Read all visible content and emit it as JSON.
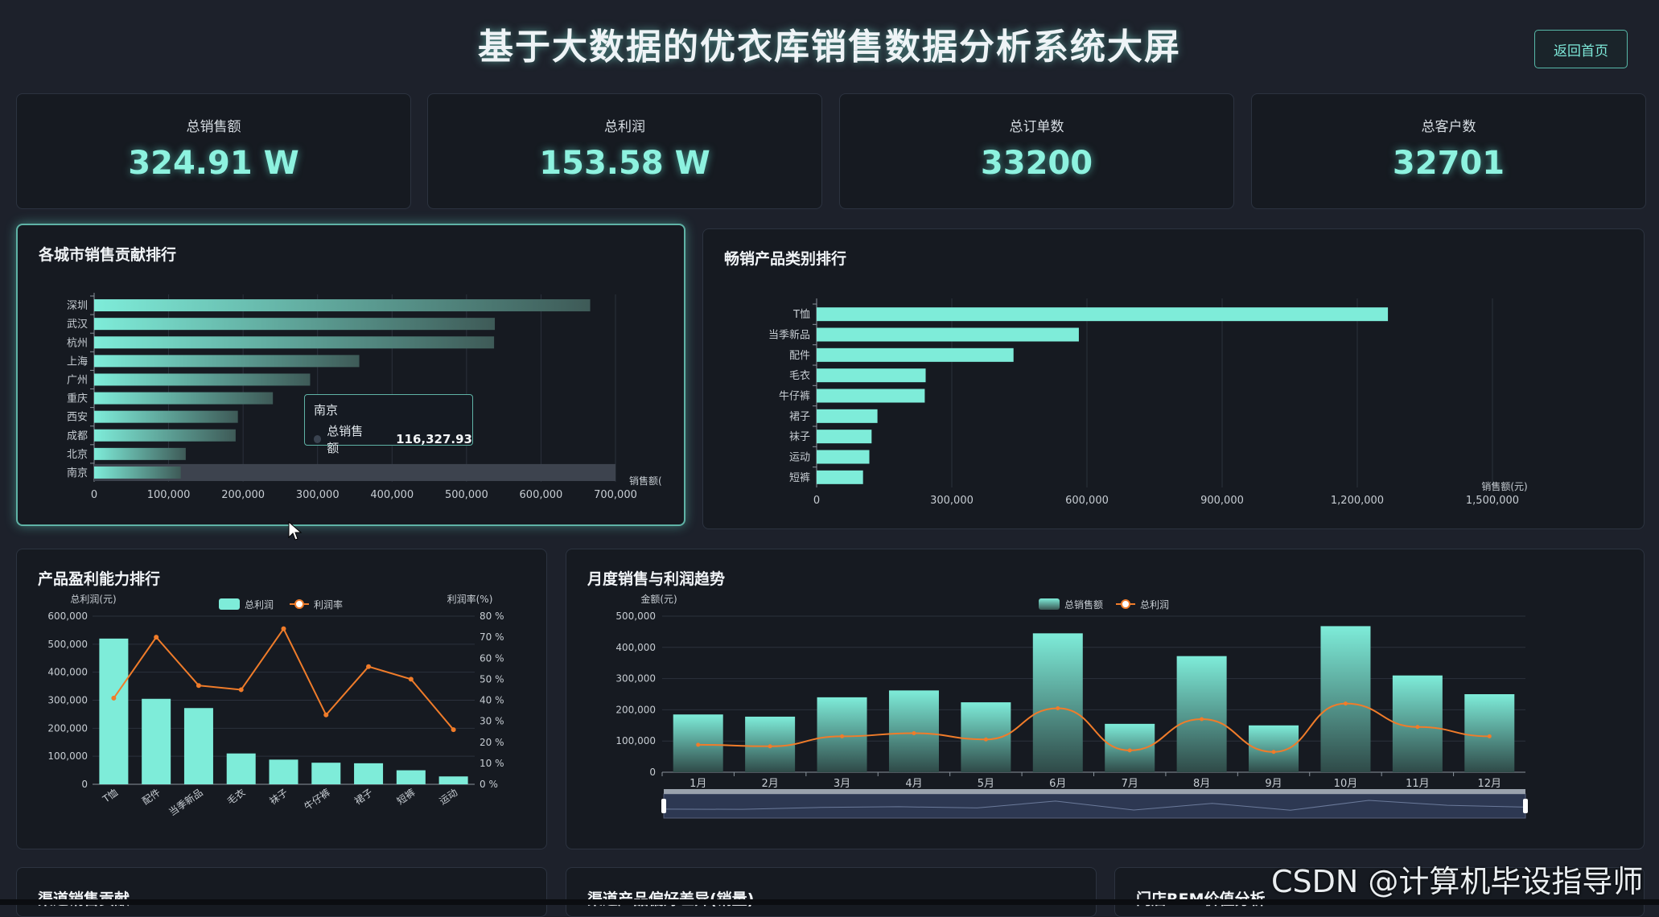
{
  "header": {
    "title": "基于大数据的优衣库销售数据分析系统大屏",
    "back_label": "返回首页"
  },
  "kpis": [
    {
      "label": "总销售额",
      "value": "324.91 W"
    },
    {
      "label": "总利润",
      "value": "153.58 W"
    },
    {
      "label": "总订单数",
      "value": "33200"
    },
    {
      "label": "总客户数",
      "value": "32701"
    }
  ],
  "panels": {
    "city": "各城市销售贡献排行",
    "category": "畅销产品类别排行",
    "profit": "产品盈利能力排行",
    "monthly": "月度销售与利润趋势",
    "channel": "渠道销售贡献",
    "channel_pref": "渠道产品偏好差异(销量)",
    "rfm": "门店RFM价值分析"
  },
  "tooltip": {
    "city": "南京",
    "label": "总销售额",
    "value": "116,327.93"
  },
  "watermark": "CSDN @计算机毕设指导师",
  "colors": {
    "accent": "#7eecd9",
    "line": "#f07c2a",
    "background": "#1d212b",
    "panel": "#161a21"
  },
  "chart_data": [
    {
      "type": "bar",
      "orientation": "horizontal",
      "categories": [
        "深圳",
        "武汉",
        "杭州",
        "上海",
        "广州",
        "重庆",
        "西安",
        "成都",
        "北京",
        "南京"
      ],
      "values": [
        666000,
        538000,
        537000,
        356000,
        290000,
        240000,
        193000,
        190000,
        123000,
        116327.93
      ],
      "xlim": [
        0,
        700000
      ],
      "xticks": [
        "0",
        "100,000",
        "200,000",
        "300,000",
        "400,000",
        "500,000",
        "600,000",
        "700,000"
      ],
      "xlabel": "销售额(",
      "highlight": "南京"
    },
    {
      "type": "bar",
      "orientation": "horizontal",
      "categories": [
        "T恤",
        "当季新品",
        "配件",
        "毛衣",
        "牛仔裤",
        "裙子",
        "袜子",
        "运动",
        "短裤"
      ],
      "values": [
        1268000,
        582000,
        437000,
        242000,
        240000,
        135000,
        122000,
        117000,
        103000
      ],
      "xlim": [
        0,
        1500000
      ],
      "xticks": [
        "0",
        "300,000",
        "600,000",
        "900,000",
        "1,200,000",
        "1,500,000"
      ],
      "xlabel": "销售额(元)"
    },
    {
      "type": "bar",
      "categories": [
        "T恤",
        "配件",
        "当季新品",
        "毛衣",
        "袜子",
        "牛仔裤",
        "裙子",
        "短裤",
        "运动"
      ],
      "series": [
        {
          "name": "总利润",
          "type": "bar",
          "values": [
            520000,
            305000,
            272000,
            110000,
            88000,
            77000,
            75000,
            50000,
            28000
          ]
        },
        {
          "name": "利润率",
          "type": "line",
          "values": [
            41,
            70,
            47,
            45,
            74,
            33,
            56,
            50,
            26
          ]
        }
      ],
      "ylabel": "总利润(元)",
      "ylabel_right": "利润率(%)",
      "ylim": [
        0,
        600000
      ],
      "ylim_right": [
        0,
        80
      ],
      "yticks": [
        "600,000",
        "500,000",
        "400,000",
        "300,000",
        "200,000",
        "100,000",
        "0"
      ],
      "yticks_right": [
        "80 %",
        "70 %",
        "60 %",
        "50 %",
        "40 %",
        "30 %",
        "20 %",
        "10 %",
        "0 %"
      ]
    },
    {
      "type": "bar",
      "categories": [
        "1月",
        "2月",
        "3月",
        "4月",
        "5月",
        "6月",
        "7月",
        "8月",
        "9月",
        "10月",
        "11月",
        "12月"
      ],
      "series": [
        {
          "name": "总销售额",
          "type": "bar",
          "values": [
            185000,
            178000,
            240000,
            262000,
            224000,
            445000,
            155000,
            372000,
            150000,
            468000,
            310000,
            250000
          ]
        },
        {
          "name": "总利润",
          "type": "line",
          "values": [
            88000,
            83000,
            115000,
            125000,
            105000,
            205000,
            70000,
            170000,
            65000,
            220000,
            145000,
            115000
          ]
        }
      ],
      "ylabel": "金额(元)",
      "ylim": [
        0,
        500000
      ],
      "yticks": [
        "500,000",
        "400,000",
        "300,000",
        "200,000",
        "100,000",
        "0"
      ]
    }
  ]
}
